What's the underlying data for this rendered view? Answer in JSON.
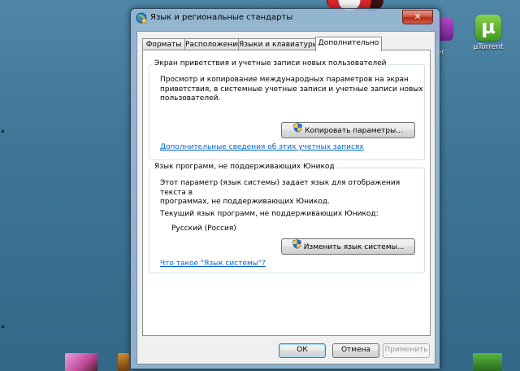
{
  "desktop": {
    "utorrent_label": "µTorrent",
    "partial_icon_label": "er"
  },
  "window": {
    "title": "Язык и региональные стандарты",
    "close_label": "✕"
  },
  "tabs": [
    {
      "label": "Форматы"
    },
    {
      "label": "Расположение"
    },
    {
      "label": "Языки и клавиатуры"
    },
    {
      "label": "Дополнительно",
      "active": true
    }
  ],
  "welcome_group": {
    "title": "Экран приветствия и учетные записи новых пользователей",
    "description_lines": [
      "Просмотр и копирование международных параметров на экран",
      "приветствия, в системные учетные записи и учетные записи новых",
      "пользователей."
    ],
    "copy_button": "Копировать параметры...",
    "link": "Дополнительные сведения об этих учетных записях"
  },
  "nonunicode_group": {
    "title": "Язык программ, не поддерживающих Юникод",
    "description_lines": [
      "Этот параметр (язык системы) задает язык для отображения текста в",
      "программах, не поддерживающих Юникод."
    ],
    "current_label": "Текущий язык программ, не поддерживающих Юникод:",
    "current_value": "Русский (Россия)",
    "change_button": "Изменить язык системы...",
    "link": "Что такое \"Язык системы\"?"
  },
  "footer": {
    "ok": "ОК",
    "cancel": "Отмена",
    "apply": "Применить"
  },
  "colors": {
    "link": "#0066cc",
    "close_button": "#c73a21",
    "desktop": "#3f7596"
  }
}
